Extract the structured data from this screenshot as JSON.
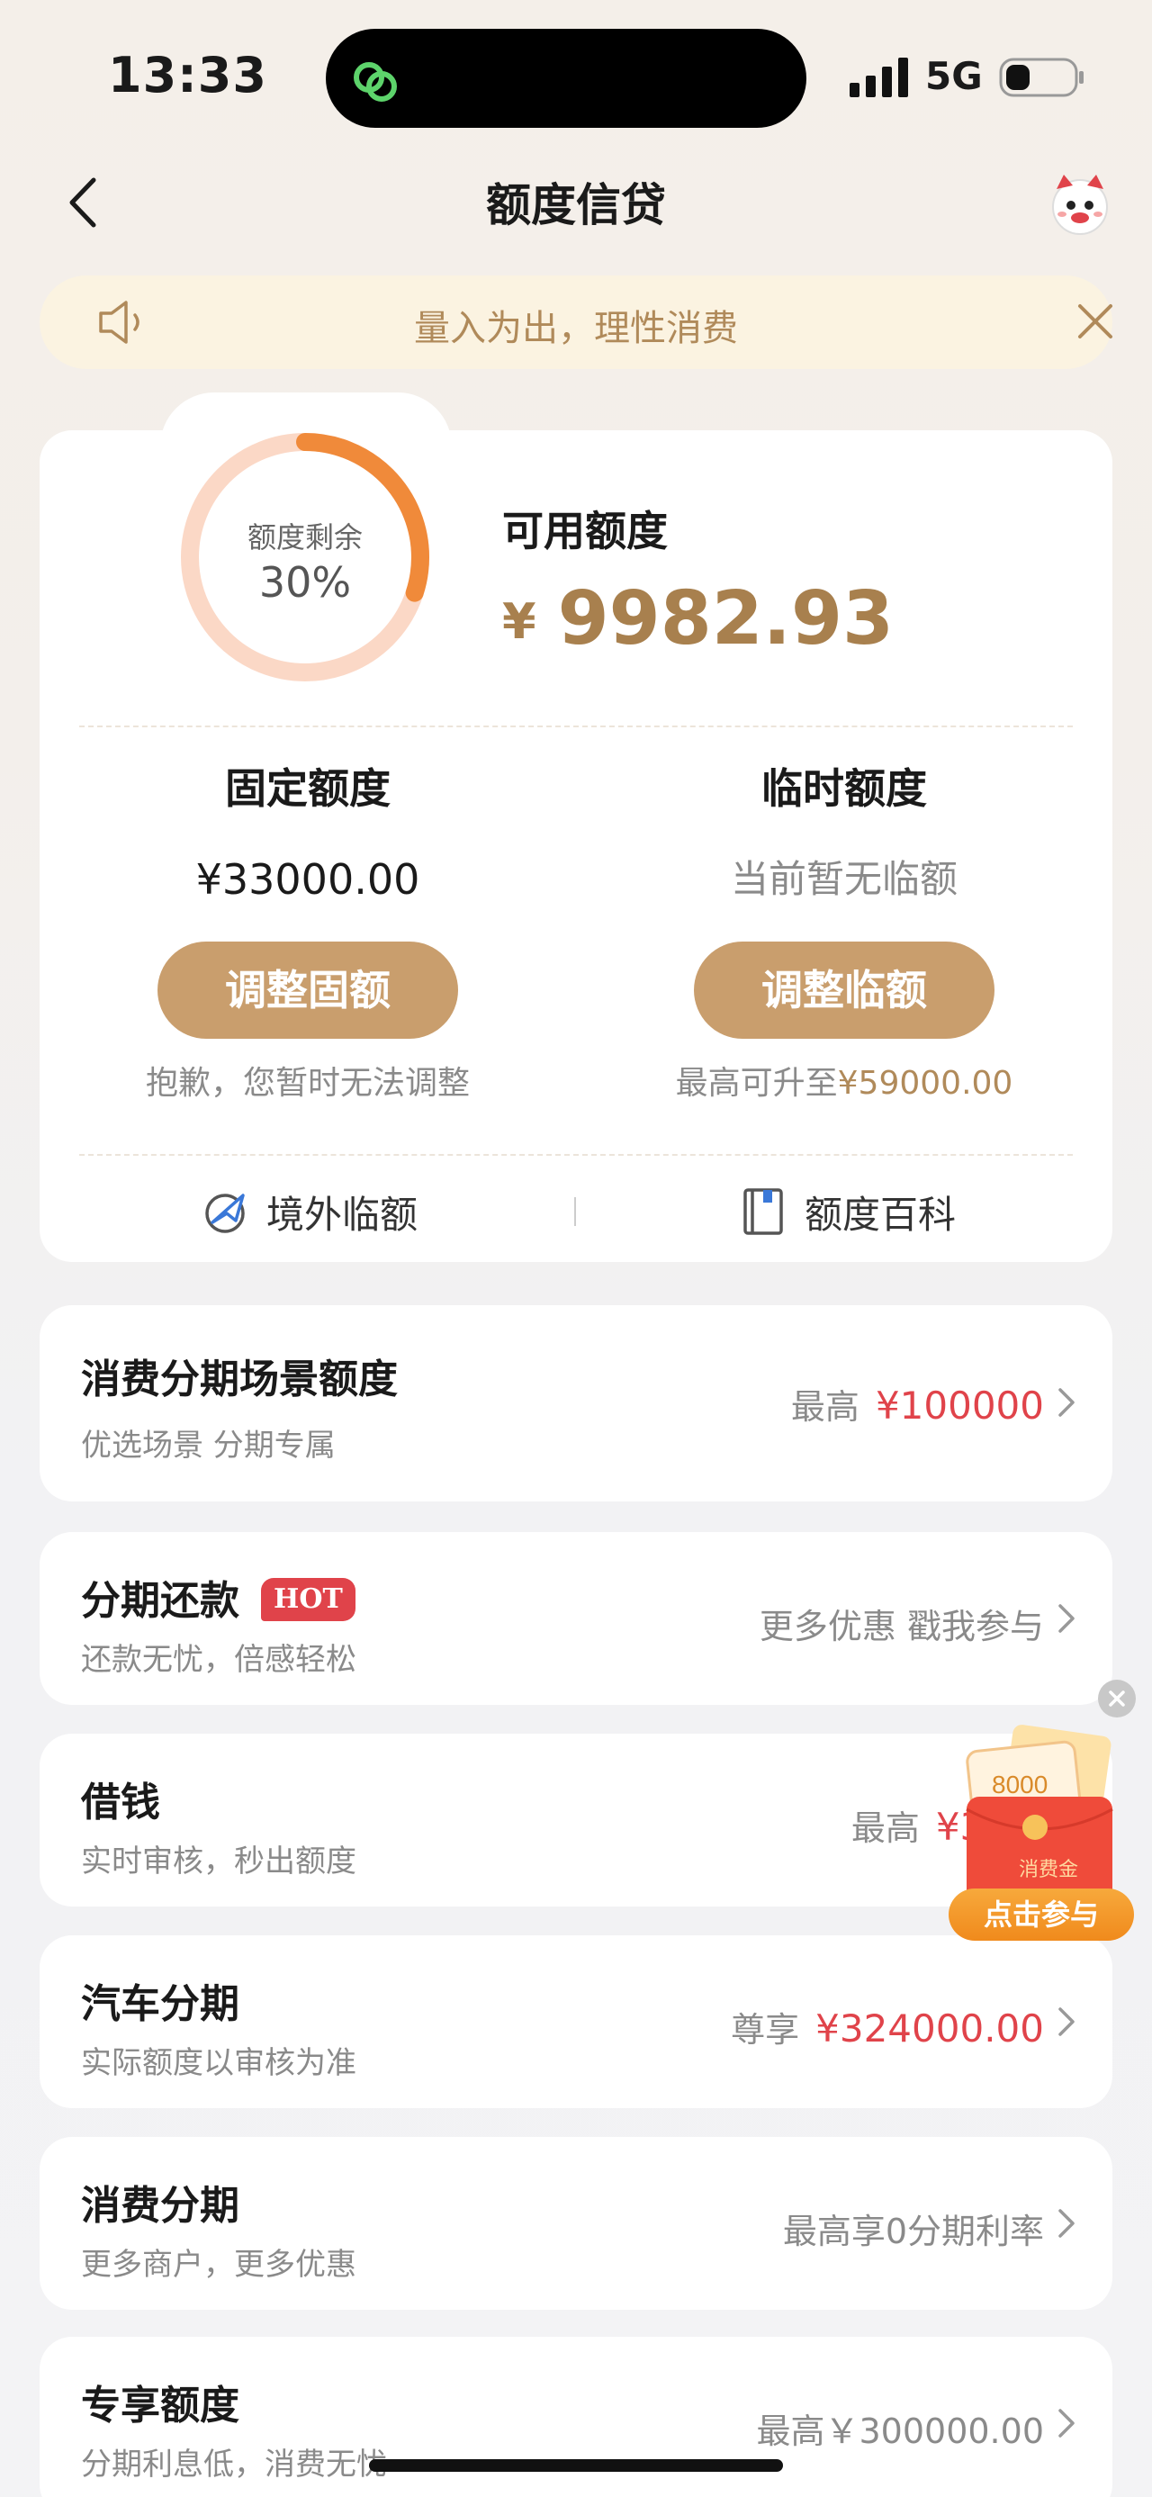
{
  "status_bar": {
    "time": "13:33",
    "network": "5G"
  },
  "nav": {
    "title": "额度信贷"
  },
  "notice": {
    "text": "量入为出，理性消费"
  },
  "credit": {
    "ring_label": "额度剩余",
    "ring_percent": "30%",
    "remaining_fraction": 0.3,
    "available_label": "可用额度",
    "currency": "¥",
    "available_amount": "9982.93",
    "fixed": {
      "title": "固定额度",
      "amount": "¥33000.00",
      "button": "调整固额",
      "note": "抱歉，您暂时无法调整"
    },
    "temp": {
      "title": "临时额度",
      "amount": "当前暂无临额",
      "button": "调整临额",
      "note_prefix": "最高可升至",
      "note_value": "¥59000.00"
    },
    "links": {
      "overseas": "境外临额",
      "wiki": "额度百科"
    }
  },
  "list": [
    {
      "title": "消费分期场景额度",
      "sub": "优选场景 分期专属",
      "right_prefix": "最高",
      "right_value": "¥100000"
    },
    {
      "title": "分期还款",
      "badge": "HOT",
      "sub": "还款无忧，倍感轻松",
      "right_text": "更多优惠 戳我参与"
    },
    {
      "title": "借钱",
      "sub": "实时审核，秒出额度",
      "right_prefix": "最高",
      "right_value": "¥33"
    },
    {
      "title": "汽车分期",
      "sub": "实际额度以审核为准",
      "right_prefix": "尊享",
      "right_value": "¥324000.00"
    },
    {
      "title": "消费分期",
      "sub": "更多商户，更多优惠",
      "right_text": "最高享0分期利率"
    },
    {
      "title": "专享额度",
      "sub": "分期利息低，消费无忧",
      "right_text": "最高￥300000.00"
    }
  ],
  "promo": {
    "amount": "8000",
    "tag": "消费金",
    "button": "点击参与"
  },
  "colors": {
    "gold": "#c99e6d",
    "gold_text": "#a8804e",
    "accent_red": "#e0434a",
    "ring_orange": "#f08a3a",
    "ring_track": "#fbd8c6"
  }
}
